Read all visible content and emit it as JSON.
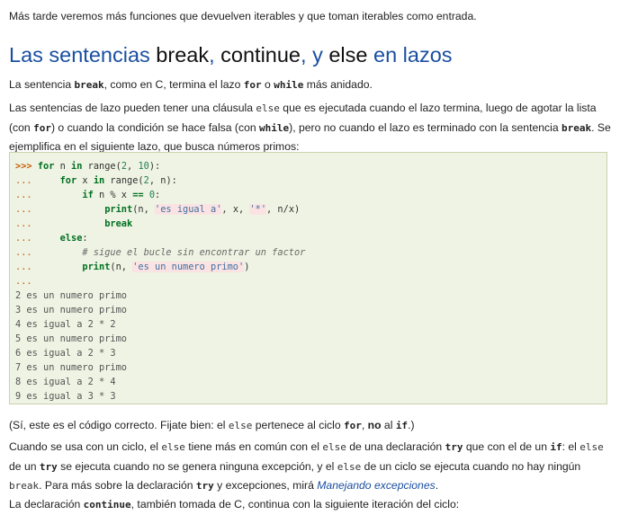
{
  "intro": "Más tarde veremos más funciones que devuelven iterables y que toman iterables como entrada.",
  "heading": {
    "part1": "Las sentencias ",
    "kw_break": "break",
    "part2": ", ",
    "kw_continue": "continue",
    "part3": ", y ",
    "kw_else": "else",
    "part4": " en lazos"
  },
  "p_break": {
    "t1": "La sentencia ",
    "c1": "break",
    "t2": ", como en C, termina el lazo ",
    "c2": "for",
    "t3": " o ",
    "c3": "while",
    "t4": " más anidado."
  },
  "p_lazos": {
    "t1": "Las sentencias de lazo pueden tener una cláusula ",
    "c1": "else",
    "t2": " que es ejecutada cuando el lazo termina, luego de agotar la lista (con ",
    "c2": "for",
    "t3": ") o cuando la condición se hace falsa (con ",
    "c3": "while",
    "t4": "), pero no cuando el lazo es terminado con la sentencia ",
    "c4": "break",
    "t5": ". Se ejemplifica en el siguiente lazo, que busca números primos:"
  },
  "code": {
    "l1": {
      "p": ">>> ",
      "k1": "for",
      "a": " n ",
      "k2": "in",
      "b": " range(",
      "n1": "2",
      "c": ", ",
      "n2": "10",
      "d": "):"
    },
    "l2": {
      "p": "...     ",
      "k1": "for",
      "a": " x ",
      "k2": "in",
      "b": " range(",
      "n1": "2",
      "c": ", n):"
    },
    "l3": {
      "p": "...         ",
      "k1": "if",
      "a": " n % x ",
      "op": "==",
      "b": " ",
      "n1": "0",
      "c": ":"
    },
    "l4": {
      "p": "...             ",
      "k1": "print",
      "a": "(n, ",
      "s1": "'es igual a'",
      "b": ", x, ",
      "s2": "'*'",
      "c": ", n/x)"
    },
    "l5": {
      "p": "...             ",
      "k1": "break"
    },
    "l6": {
      "p": "...     ",
      "k1": "else",
      "a": ":"
    },
    "l7": {
      "p": "...         ",
      "cm": "# sigue el bucle sin encontrar un factor"
    },
    "l8": {
      "p": "...         ",
      "k1": "print",
      "a": "(n, ",
      "s1": "'es un numero primo'",
      "b": ")"
    },
    "l9": {
      "p": "..."
    },
    "output": [
      "2 es un numero primo",
      "3 es un numero primo",
      "4 es igual a 2 * 2",
      "5 es un numero primo",
      "6 es igual a 2 * 3",
      "7 es un numero primo",
      "8 es igual a 2 * 4",
      "9 es igual a 3 * 3"
    ]
  },
  "p_note": {
    "t1": "(Sí, este es el código correcto. Fijate bien: el ",
    "c1": "else",
    "t2": " pertenece al ciclo ",
    "c2": "for",
    "t3": ", ",
    "b1": "no",
    "t4": " al ",
    "c3": "if",
    "t5": ".)"
  },
  "p_try": {
    "t1": "Cuando se usa con un ciclo, el ",
    "c1": "else",
    "t2": " tiene más en común con el ",
    "c2": "else",
    "t3": " de una declaración ",
    "c3": "try",
    "t4": " que con el de un ",
    "c4": "if",
    "t5": ": el ",
    "c5": "else",
    "t6": " de un ",
    "c6": "try",
    "t7": " se ejecuta cuando no se genera ninguna excepción, y el ",
    "c7": "else",
    "t8": " de un ciclo se ejecuta cuando no hay ningún ",
    "c8": "break",
    "t9": ". Para más sobre la declaración ",
    "c9": "try",
    "t10": " y excepciones, mirá ",
    "link": "Manejando excepciones",
    "t11": "."
  },
  "p_continue": {
    "t1": "La declaración ",
    "c1": "continue",
    "t2": ", también tomada de C, continua con la siguiente iteración del ciclo:"
  }
}
